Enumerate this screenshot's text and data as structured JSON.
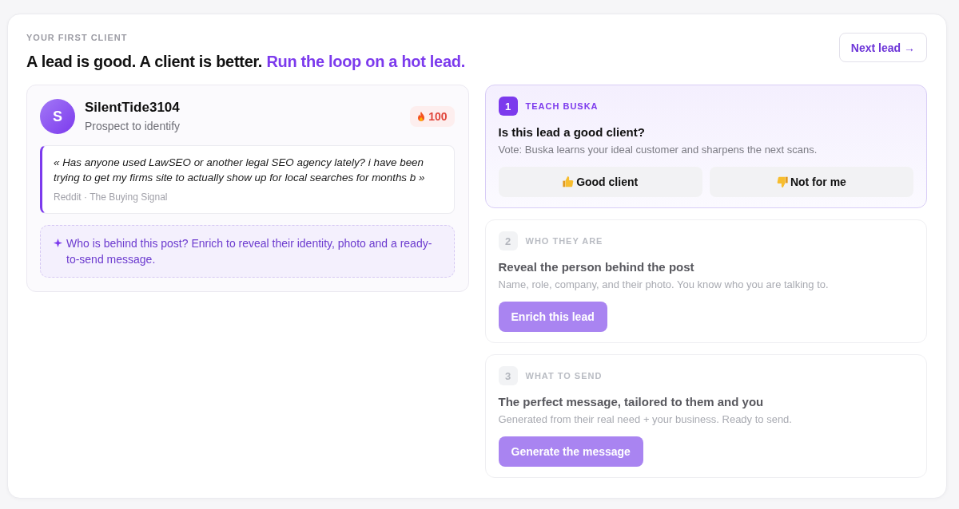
{
  "eyebrow": "YOUR FIRST CLIENT",
  "headline": {
    "text": "A lead is good. A client is better.",
    "highlight": "Run the loop on a hot lead."
  },
  "next_button": {
    "label": "Next lead →"
  },
  "lead": {
    "avatar_letter": "S",
    "name": "SilentTide3104",
    "status": "Prospect to identify",
    "score": "100",
    "quote": "« Has anyone used LawSEO or another legal SEO agency lately? i have been trying to get my firms site to actually show up for local searches for months b »",
    "source": "Reddit · The Buying Signal",
    "hint": "Who is behind this post? Enrich to reveal their identity, photo and a ready-to-send message."
  },
  "steps": [
    {
      "number": "1",
      "label": "TEACH BUSKA",
      "title": "Is this lead a good client?",
      "description": "Vote: Buska learns your ideal customer and sharpens the next scans.",
      "active": true,
      "buttons": [
        {
          "kind": "approve",
          "label": "Good client"
        },
        {
          "kind": "reject",
          "label": "Not for me"
        }
      ]
    },
    {
      "number": "2",
      "label": "WHO THEY ARE",
      "title": "Reveal the person behind the post",
      "description": "Name, role, company, and their photo. You know who you are talking to.",
      "active": false,
      "buttons": [
        {
          "kind": "primary",
          "label": "Enrich this lead"
        }
      ]
    },
    {
      "number": "3",
      "label": "WHAT TO SEND",
      "title": "The perfect message, tailored to them and you",
      "description": "Generated from their real need + your business. Ready to send.",
      "active": false,
      "buttons": [
        {
          "kind": "primary",
          "label": "Generate the message"
        }
      ]
    }
  ]
}
